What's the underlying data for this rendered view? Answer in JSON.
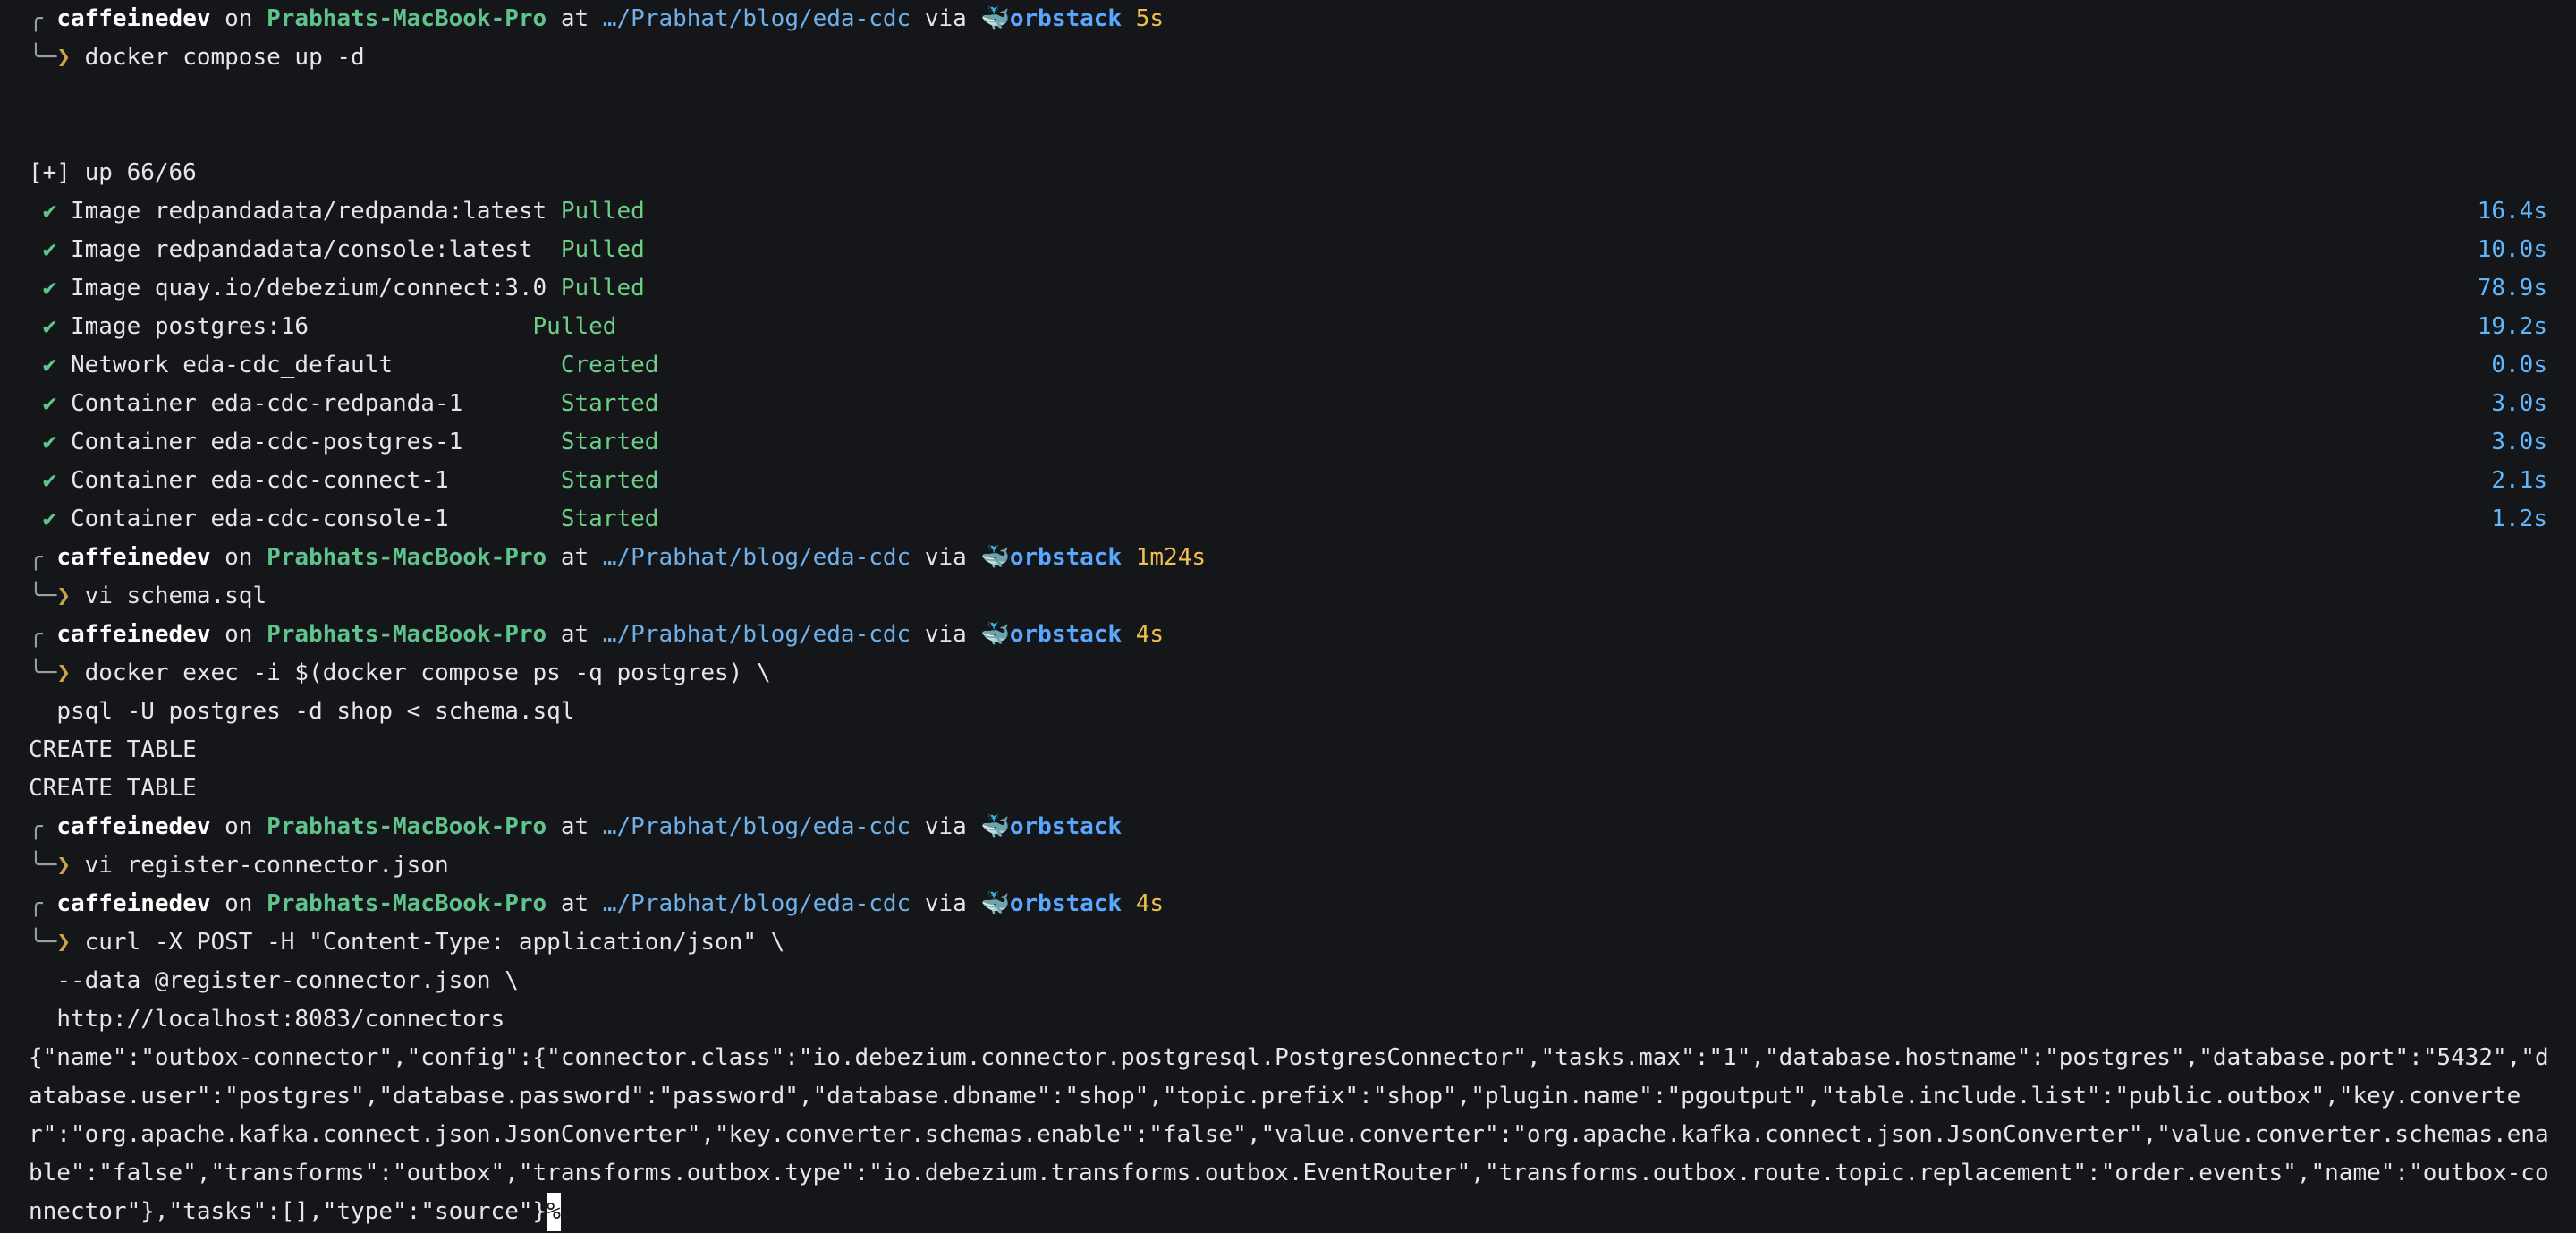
{
  "prompts": [
    {
      "user": "caffeinedev",
      "host": "Prabhats-MacBook-Pro",
      "path": "…/Prabhat/blog/eda-cdc",
      "ctx": "orbstack",
      "dur": "5s",
      "cmd": [
        "docker compose up -d"
      ]
    },
    {
      "user": "caffeinedev",
      "host": "Prabhats-MacBook-Pro",
      "path": "…/Prabhat/blog/eda-cdc",
      "ctx": "orbstack",
      "dur": "1m24s",
      "cmd": [
        "vi schema.sql"
      ]
    },
    {
      "user": "caffeinedev",
      "host": "Prabhats-MacBook-Pro",
      "path": "…/Prabhat/blog/eda-cdc",
      "ctx": "orbstack",
      "dur": "4s",
      "cmd": [
        "docker exec -i $(docker compose ps -q postgres) \\",
        "psql -U postgres -d shop < schema.sql"
      ]
    },
    {
      "user": "caffeinedev",
      "host": "Prabhats-MacBook-Pro",
      "path": "…/Prabhat/blog/eda-cdc",
      "ctx": "orbstack",
      "dur": "",
      "cmd": [
        "vi register-connector.json"
      ]
    },
    {
      "user": "caffeinedev",
      "host": "Prabhats-MacBook-Pro",
      "path": "…/Prabhat/blog/eda-cdc",
      "ctx": "orbstack",
      "dur": "4s",
      "cmd": [
        "curl -X POST -H \"Content-Type: application/json\" \\",
        "--data @register-connector.json \\",
        "http://localhost:8083/connectors"
      ]
    }
  ],
  "words": {
    "on": "on",
    "at": "at",
    "via": "via",
    "check": "✔",
    "arrow": "❯",
    "apple": "",
    "docker": "🐳"
  },
  "compose": {
    "header": "[+] up 66/66",
    "items": [
      {
        "name": "Image redpandadata/redpanda:latest",
        "status": "Pulled",
        "time": "16.4s"
      },
      {
        "name": "Image redpandadata/console:latest ",
        "status": "Pulled",
        "time": "10.0s"
      },
      {
        "name": "Image quay.io/debezium/connect:3.0",
        "status": "Pulled",
        "time": "78.9s"
      },
      {
        "name": "Image postgres:16               ",
        "status": "Pulled",
        "time": "19.2s"
      },
      {
        "name": "Network eda-cdc_default           ",
        "status": "Created",
        "time": "0.0s"
      },
      {
        "name": "Container eda-cdc-redpanda-1      ",
        "status": "Started",
        "time": "3.0s"
      },
      {
        "name": "Container eda-cdc-postgres-1      ",
        "status": "Started",
        "time": "3.0s"
      },
      {
        "name": "Container eda-cdc-connect-1       ",
        "status": "Started",
        "time": "2.1s"
      },
      {
        "name": "Container eda-cdc-console-1       ",
        "status": "Started",
        "time": "1.2s"
      }
    ]
  },
  "sql_output": [
    "CREATE TABLE",
    "CREATE TABLE"
  ],
  "curl_output": "{\"name\":\"outbox-connector\",\"config\":{\"connector.class\":\"io.debezium.connector.postgresql.PostgresConnector\",\"tasks.max\":\"1\",\"database.hostname\":\"postgres\",\"database.port\":\"5432\",\"database.user\":\"postgres\",\"database.password\":\"password\",\"database.dbname\":\"shop\",\"topic.prefix\":\"shop\",\"plugin.name\":\"pgoutput\",\"table.include.list\":\"public.outbox\",\"key.converter\":\"org.apache.kafka.connect.json.JsonConverter\",\"key.converter.schemas.enable\":\"false\",\"value.converter\":\"org.apache.kafka.connect.json.JsonConverter\",\"value.converter.schemas.enable\":\"false\",\"transforms\":\"outbox\",\"transforms.outbox.type\":\"io.debezium.transforms.outbox.EventRouter\",\"transforms.outbox.route.topic.replacement\":\"order.events\",\"name\":\"outbox-connector\"},\"tasks\":[],\"type\":\"source\"}",
  "end_marker": "%"
}
